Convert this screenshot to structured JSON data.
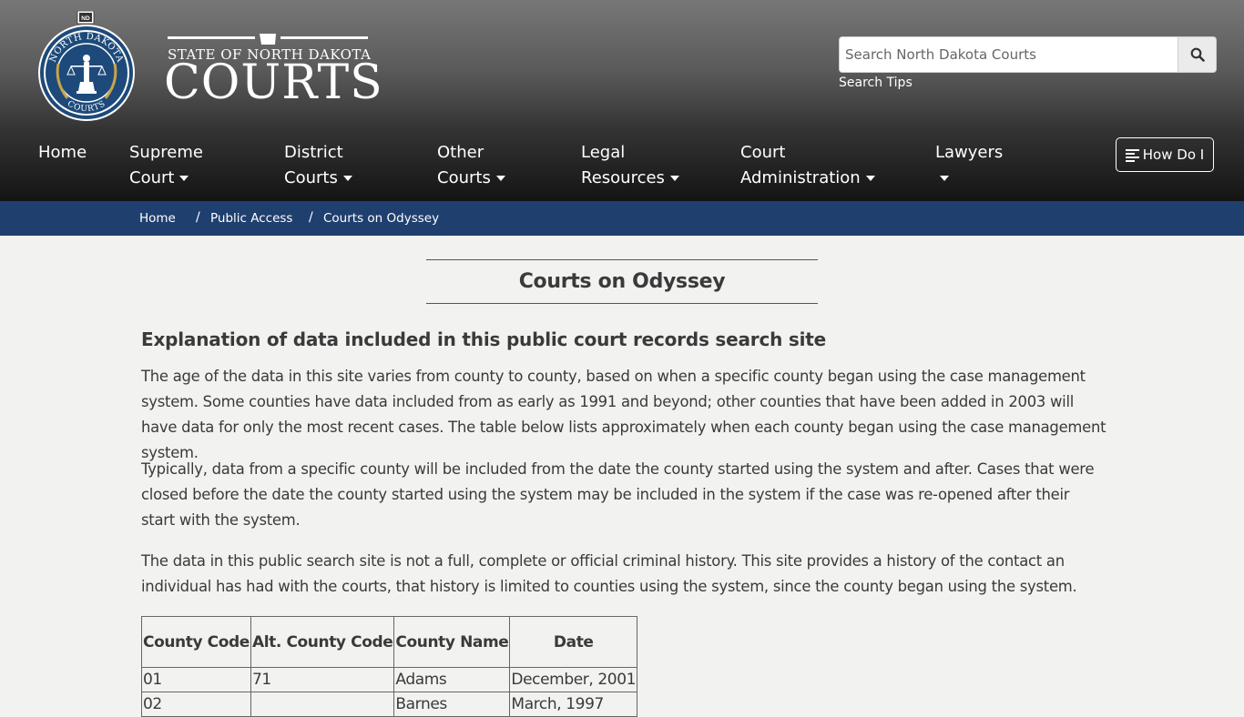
{
  "header": {
    "seal": {
      "ring_text_top": "NORTH DAKOTA",
      "ring_text_bottom": "COURTS",
      "badge": "ND"
    },
    "wordmark": {
      "line1": "STATE OF NORTH DAKOTA",
      "line2": "COURTS"
    },
    "search": {
      "placeholder": "Search North Dakota Courts",
      "button_icon": "search-icon",
      "tips_label": "Search Tips"
    }
  },
  "nav": {
    "items": [
      {
        "line1": "Home",
        "line2": ""
      },
      {
        "line1": "Supreme",
        "line2": "Court"
      },
      {
        "line1": "District",
        "line2": "Courts"
      },
      {
        "line1": "Other",
        "line2": "Courts"
      },
      {
        "line1": "Legal",
        "line2": "Resources"
      },
      {
        "line1": "Court",
        "line2": "Administration"
      },
      {
        "line1": "Lawyers",
        "line2": ""
      }
    ],
    "how_do_i": "How Do I"
  },
  "breadcrumb": {
    "items": [
      "Home",
      "Public Access",
      "Courts on Odyssey"
    ],
    "separator": "/"
  },
  "main": {
    "title": "Courts on Odyssey",
    "subheading": "Explanation of data included in this public court records search site",
    "paragraphs": [
      "The age of the data in this site varies from county to county, based on when a specific county began using the case management system. Some counties have data included from as early as 1991 and beyond; other counties that have been added in 2003 will have data for only the most recent cases. The table below lists approximately when each county began using the case management system.",
      "Typically, data from a specific county will be included from the date the county started using the system and after. Cases that were closed before the date the county started using the system may be included in the system if the case was re-opened after their start with the system.",
      "The data in this public search site is not a full, complete or official criminal history. This site provides a history of the contact an individual has had with the courts, that history is limited to counties using the system, since the county began using the system."
    ],
    "table": {
      "headers": [
        "County Code",
        "Alt. County Code",
        "County Name",
        "Date"
      ],
      "rows": [
        [
          "01",
          "71",
          "Adams",
          "December, 2001"
        ],
        [
          "02",
          "",
          "Barnes",
          "March, 1997"
        ]
      ]
    }
  },
  "colors": {
    "breadcrumb_bg": "#1f3f6e",
    "seal_blue": "#1d4a7a",
    "seal_gold": "#c9a44a"
  }
}
